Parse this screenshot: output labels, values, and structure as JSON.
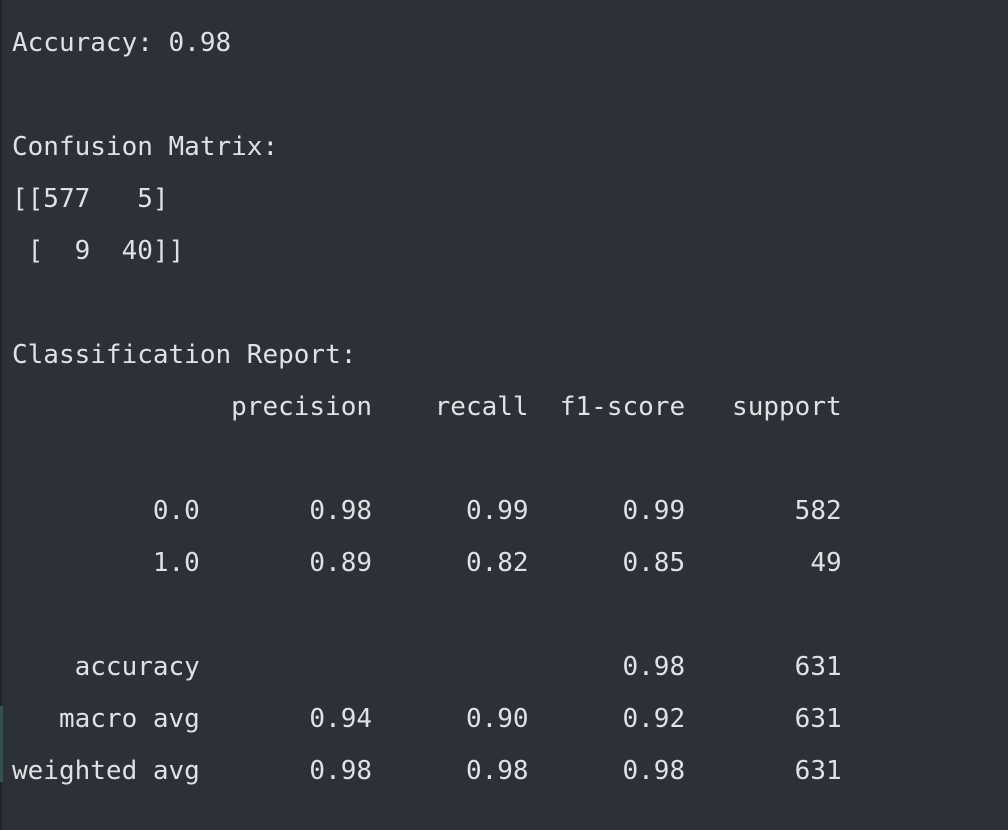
{
  "console": {
    "lines": [
      "Accuracy: 0.98",
      "",
      "Confusion Matrix:",
      "[[577   5]",
      " [  9  40]]",
      "",
      "Classification Report:",
      "              precision    recall  f1-score   support",
      "",
      "         0.0       0.98      0.99      0.99       582",
      "         1.0       0.89      0.82      0.85        49",
      "",
      "    accuracy                           0.98       631",
      "   macro avg       0.94      0.90      0.92       631",
      "weighted avg       0.98      0.98      0.98       631"
    ]
  },
  "colors": {
    "background": "#2b3137",
    "text": "#dfe1e5",
    "gutter_marker": "#35504a"
  }
}
